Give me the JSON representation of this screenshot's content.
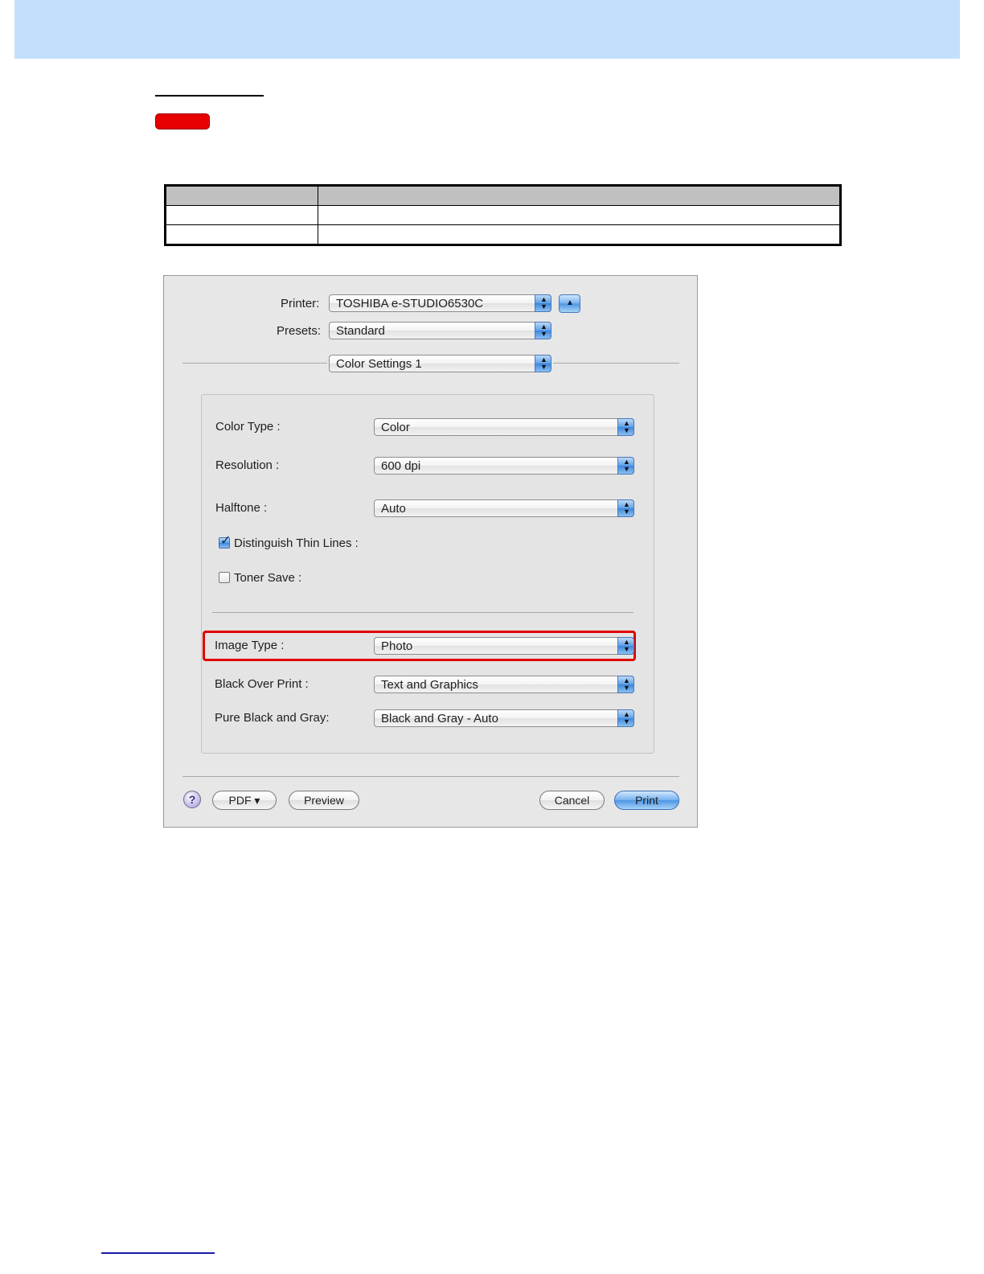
{
  "dialog": {
    "printer_label": "Printer:",
    "printer_value": "TOSHIBA e-STUDIO6530C",
    "presets_label": "Presets:",
    "presets_value": "Standard",
    "panel_value": "Color Settings 1",
    "settings": {
      "color_type_label": "Color Type :",
      "color_type_value": "Color",
      "resolution_label": "Resolution :",
      "resolution_value": "600 dpi",
      "halftone_label": "Halftone :",
      "halftone_value": "Auto",
      "thin_lines_label": "Distinguish Thin Lines :",
      "thin_lines_checked": true,
      "toner_save_label": "Toner Save :",
      "toner_save_checked": false,
      "image_type_label": "Image Type :",
      "image_type_value": "Photo",
      "black_over_print_label": "Black Over Print :",
      "black_over_print_value": "Text and Graphics",
      "pure_black_label": "Pure Black and Gray:",
      "pure_black_value": "Black and Gray - Auto"
    },
    "buttons": {
      "help": "?",
      "pdf": "PDF ▾",
      "preview": "Preview",
      "cancel": "Cancel",
      "print": "Print"
    }
  },
  "icons": {
    "popup_arrows": "▲▼",
    "disclosure_up": "▲",
    "check": "✓"
  },
  "colors": {
    "header_band": "#c2e0fb",
    "highlight_box": "#e00000",
    "badge": "#e60000"
  }
}
